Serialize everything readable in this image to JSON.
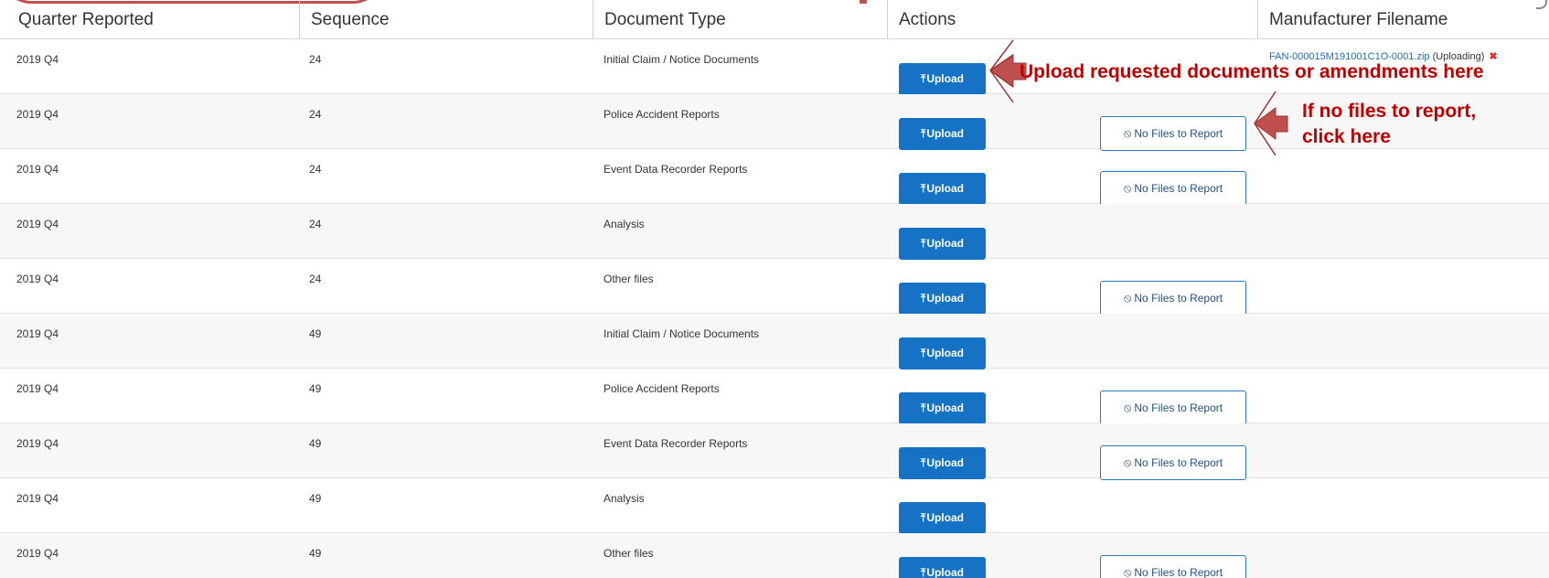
{
  "table": {
    "columns": [
      "Quarter Reported",
      "Sequence",
      "Document Type",
      "Actions",
      "Manufacturer Filename"
    ],
    "upload_label": "Upload",
    "no_files_label": "No Files to Report",
    "rows": [
      {
        "quarter": "2019 Q4",
        "sequence": "24",
        "doc_type": "Initial Claim / Notice Documents",
        "no_files": false
      },
      {
        "quarter": "2019 Q4",
        "sequence": "24",
        "doc_type": "Police Accident Reports",
        "no_files": true
      },
      {
        "quarter": "2019 Q4",
        "sequence": "24",
        "doc_type": "Event Data Recorder Reports",
        "no_files": true
      },
      {
        "quarter": "2019 Q4",
        "sequence": "24",
        "doc_type": "Analysis",
        "no_files": false
      },
      {
        "quarter": "2019 Q4",
        "sequence": "24",
        "doc_type": "Other files",
        "no_files": true
      },
      {
        "quarter": "2019 Q4",
        "sequence": "49",
        "doc_type": "Initial Claim / Notice Documents",
        "no_files": false
      },
      {
        "quarter": "2019 Q4",
        "sequence": "49",
        "doc_type": "Police Accident Reports",
        "no_files": true
      },
      {
        "quarter": "2019 Q4",
        "sequence": "49",
        "doc_type": "Event Data Recorder Reports",
        "no_files": true
      },
      {
        "quarter": "2019 Q4",
        "sequence": "49",
        "doc_type": "Analysis",
        "no_files": false
      },
      {
        "quarter": "2019 Q4",
        "sequence": "49",
        "doc_type": "Other files",
        "no_files": true
      }
    ]
  },
  "file": {
    "name": "FAN-000015M191001C1O-0001.zip",
    "status": "(Uploading)",
    "remove_icon": "close-icon"
  },
  "annotations": {
    "upload_hint": "Upload requested documents or amendments here",
    "no_files_hint_line1": "If no files to report,",
    "no_files_hint_line2": "click here"
  },
  "colors": {
    "primary": "#1572c4",
    "annotation": "#c00000",
    "arrow": "#c0504d"
  }
}
